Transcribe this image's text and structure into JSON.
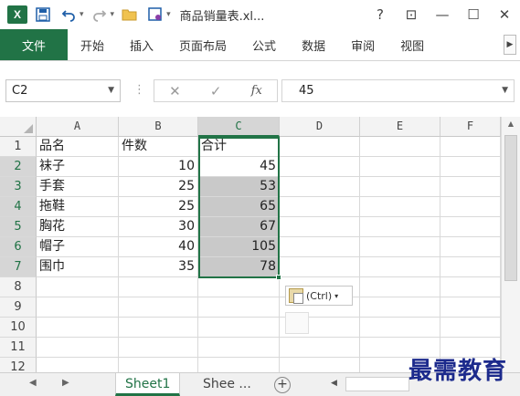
{
  "window": {
    "title": "商品销量表.xl...",
    "help_label": "?",
    "restore_ribbon_label": "⊡",
    "minimize_label": "—",
    "maximize_label": "☐",
    "close_label": "✕"
  },
  "quick_access": {
    "app_icon_label": "X",
    "save_icon": "save-icon",
    "undo_icon": "undo-icon",
    "redo_icon": "redo-icon",
    "open_icon": "folder-icon",
    "touch_icon": "touch-mode-icon"
  },
  "ribbon": {
    "file_label": "文件",
    "tabs": [
      "开始",
      "插入",
      "页面布局",
      "公式",
      "数据",
      "审阅",
      "视图"
    ]
  },
  "formula_bar": {
    "name_box": "C2",
    "value": "45",
    "fx_label": "fx",
    "cancel_glyph": "✕",
    "enter_glyph": "✓"
  },
  "columns": [
    "A",
    "B",
    "C",
    "D",
    "E",
    "F"
  ],
  "rows": [
    {
      "n": "1",
      "a": "品名",
      "b": "件数",
      "c": "合计"
    },
    {
      "n": "2",
      "a": "袜子",
      "b": "10",
      "c": "45"
    },
    {
      "n": "3",
      "a": "手套",
      "b": "25",
      "c": "53"
    },
    {
      "n": "4",
      "a": "拖鞋",
      "b": "25",
      "c": "65"
    },
    {
      "n": "5",
      "a": "胸花",
      "b": "30",
      "c": "67"
    },
    {
      "n": "6",
      "a": "帽子",
      "b": "40",
      "c": "105"
    },
    {
      "n": "7",
      "a": "围巾",
      "b": "35",
      "c": "78"
    },
    {
      "n": "8",
      "a": "",
      "b": "",
      "c": ""
    },
    {
      "n": "9",
      "a": "",
      "b": "",
      "c": ""
    },
    {
      "n": "10",
      "a": "",
      "b": "",
      "c": ""
    },
    {
      "n": "11",
      "a": "",
      "b": "",
      "c": ""
    },
    {
      "n": "12",
      "a": "",
      "b": "",
      "c": ""
    }
  ],
  "paste_options": {
    "label": "(Ctrl)"
  },
  "sheets": {
    "active": "Sheet1",
    "other": "Shee ...",
    "add_label": "+"
  },
  "watermark": "最需教育",
  "colors": {
    "accent": "#217346",
    "selection": "#c9c9c9"
  }
}
